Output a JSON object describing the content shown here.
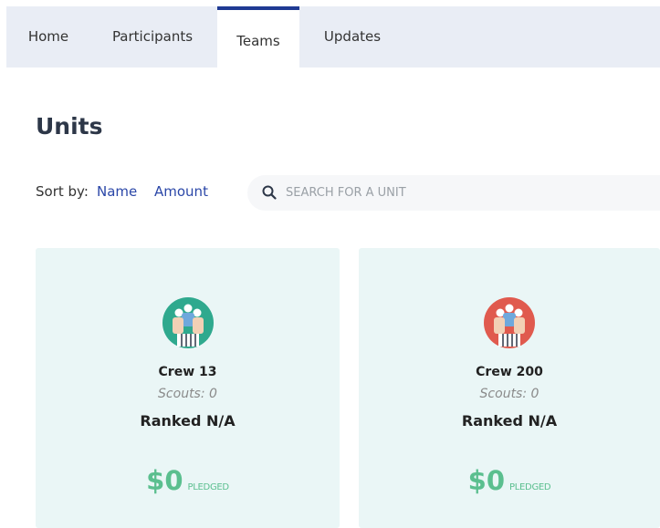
{
  "tabs": [
    {
      "label": "Home"
    },
    {
      "label": "Participants"
    },
    {
      "label": "Teams"
    },
    {
      "label": "Updates"
    }
  ],
  "active_tab": "Teams",
  "page_title": "Units",
  "sort": {
    "label": "Sort by:",
    "options": [
      "Name",
      "Amount"
    ]
  },
  "search": {
    "placeholder": "SEARCH FOR A UNIT",
    "value": "",
    "icon": "search-icon"
  },
  "units": [
    {
      "name": "Crew 13",
      "scouts": "Scouts: 0",
      "rank": "Ranked N/A",
      "amount": "$0",
      "amount_label": "PLEDGED",
      "avatar_color": "#2fa98e"
    },
    {
      "name": "Crew 200",
      "scouts": "Scouts: 0",
      "rank": "Ranked N/A",
      "amount": "$0",
      "amount_label": "PLEDGED",
      "avatar_color": "#e05a4e"
    }
  ],
  "colors": {
    "accent": "#2b47a8",
    "active_tab_border": "#1f3a93",
    "amount": "#5bbf8f",
    "card_bg": "#eaf6f6"
  }
}
